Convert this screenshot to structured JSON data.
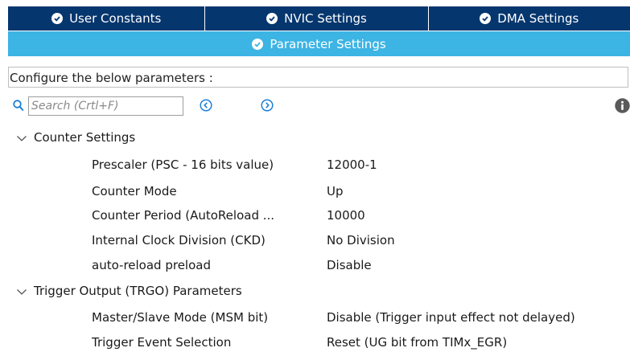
{
  "tabs": {
    "user_constants": "User Constants",
    "nvic_settings": "NVIC Settings",
    "dma_settings": "DMA Settings",
    "parameter_settings": "Parameter Settings"
  },
  "configure_text": "Configure the below parameters :",
  "search": {
    "placeholder": "Search (Crtl+F)",
    "value": ""
  },
  "groups": [
    {
      "title": "Counter Settings",
      "params": [
        {
          "label": "Prescaler (PSC - 16 bits value)",
          "value": "12000-1"
        },
        {
          "label": "Counter Mode",
          "value": "Up"
        },
        {
          "label": "Counter Period (AutoReload ...",
          "value": "10000"
        },
        {
          "label": "Internal Clock Division (CKD)",
          "value": "No Division"
        },
        {
          "label": "auto-reload preload",
          "value": "Disable"
        }
      ]
    },
    {
      "title": "Trigger Output (TRGO) Parameters",
      "params": [
        {
          "label": "Master/Slave Mode (MSM bit)",
          "value": "Disable (Trigger input effect not delayed)"
        },
        {
          "label": "Trigger Event Selection",
          "value": "Reset (UG bit from TIMx_EGR)"
        }
      ]
    }
  ],
  "icons": {
    "tab_check": "check-circle-icon",
    "search": "search-icon",
    "prev": "arrow-left-circle-icon",
    "next": "arrow-right-circle-icon",
    "info": "info-icon",
    "expand": "chevron-down-icon"
  },
  "colors": {
    "tab_bar": "#05366e",
    "active_tab": "#3cb4e4",
    "icon_blue": "#1e7fd6"
  }
}
